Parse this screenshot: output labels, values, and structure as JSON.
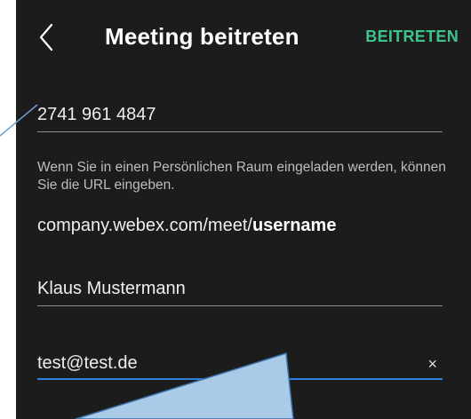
{
  "header": {
    "back_icon": "chevron-left-icon",
    "title": "Meeting beitreten",
    "join_label": "BEITRETEN"
  },
  "form": {
    "meeting_number": "2741 961 4847",
    "hint": "Wenn Sie in einen Persönlichen Raum eingeladen werden, können Sie die URL eingeben.",
    "url_prefix": "company.webex.com/meet/",
    "url_suffix": "username",
    "name": "Klaus Mustermann",
    "email": "test@test.de",
    "clear_icon": "close-icon",
    "clear_glyph": "×"
  },
  "colors": {
    "background": "#1c1c1c",
    "accent_green": "#3ec48a",
    "active_underline": "#2f7fdc",
    "callout_fill": "#a9cbe8"
  }
}
